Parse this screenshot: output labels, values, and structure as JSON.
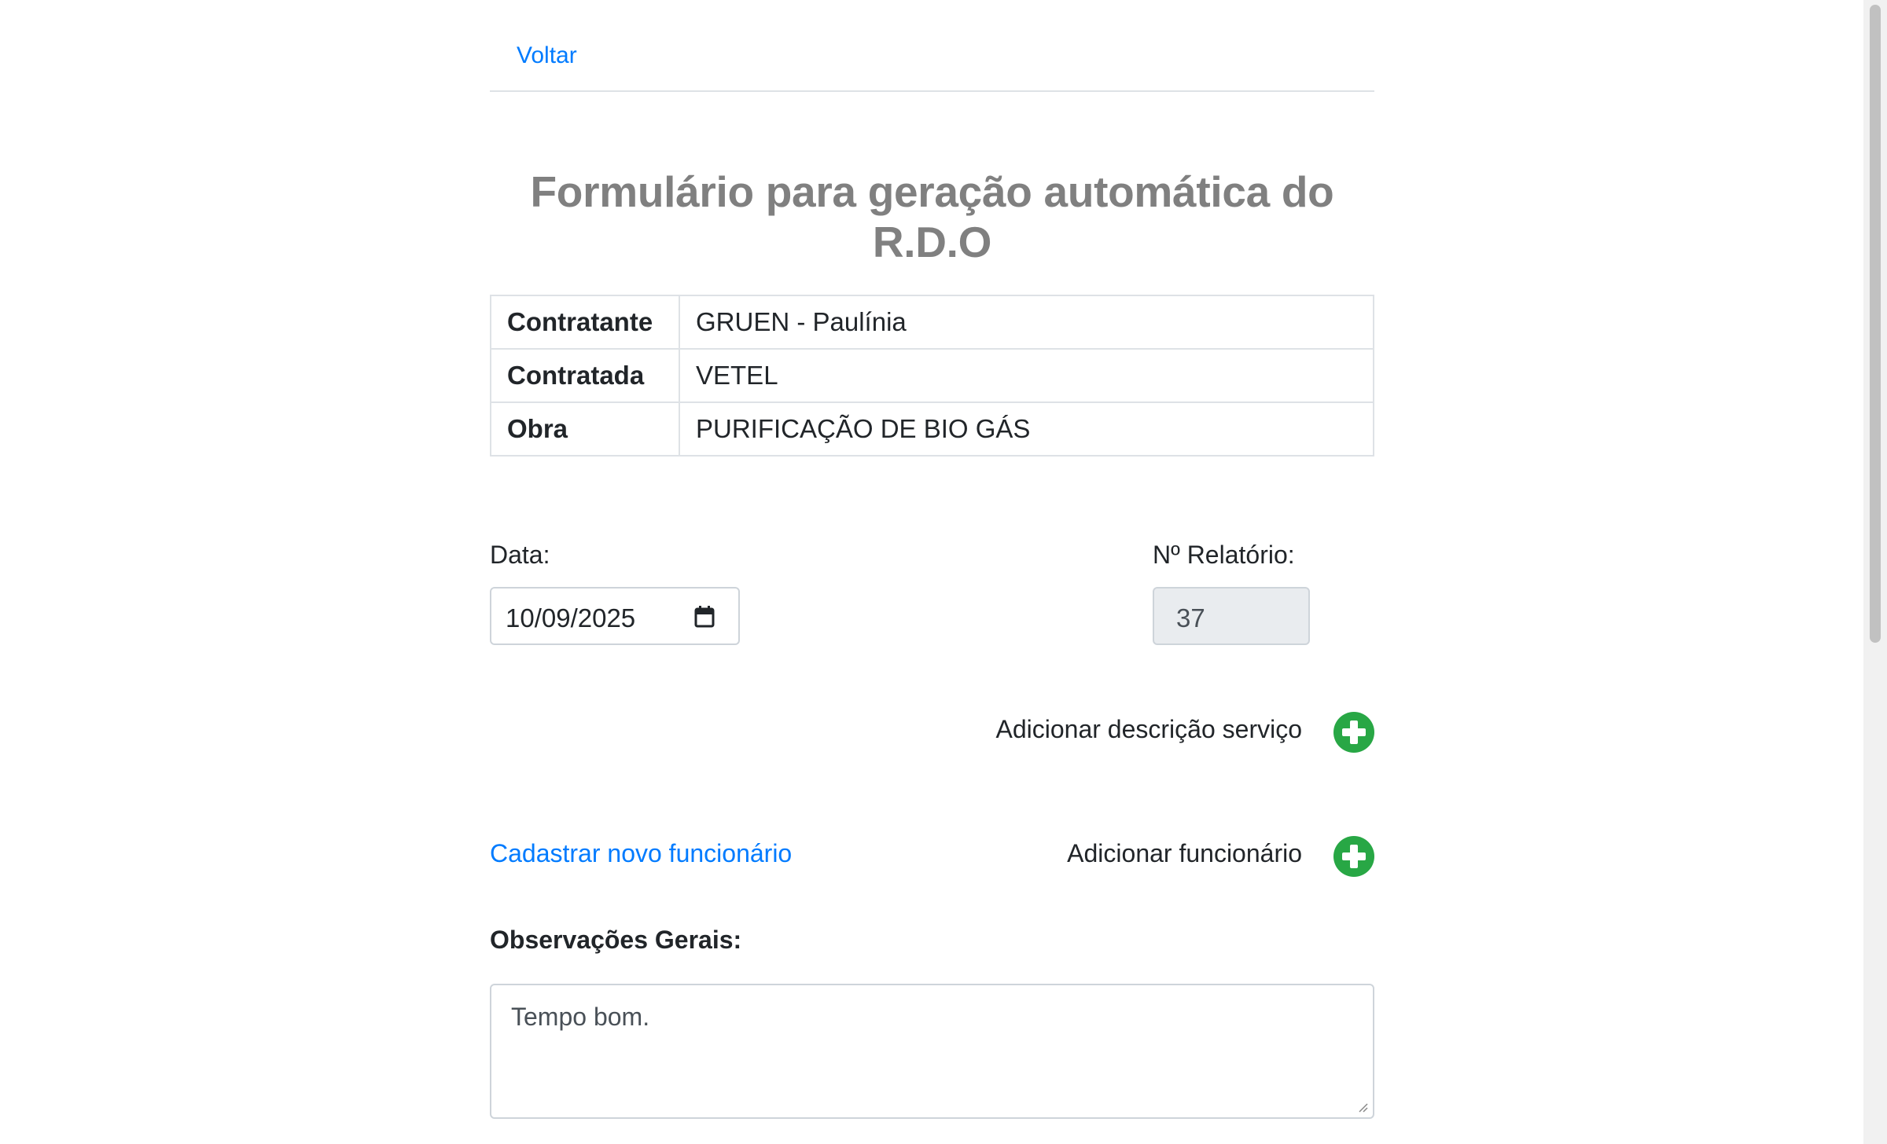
{
  "nav": {
    "back_label": "Voltar"
  },
  "page": {
    "title": "Formulário para geração automática do R.D.O"
  },
  "info_table": {
    "rows": [
      {
        "key": "Contratante",
        "value": "GRUEN - Paulínia"
      },
      {
        "key": "Contratada",
        "value": "VETEL"
      },
      {
        "key": "Obra",
        "value": "PURIFICAÇÃO DE BIO GÁS"
      }
    ]
  },
  "form": {
    "date_label": "Data:",
    "date_value": "10/09/2025",
    "report_label": "Nº Relatório:",
    "report_value": "37",
    "add_service_label": "Adicionar descrição serviço",
    "register_employee_link": "Cadastrar novo funcionário",
    "add_employee_label": "Adicionar funcionário",
    "observations_label": "Observações Gerais:",
    "observations_value": "Tempo bom."
  },
  "icons": {
    "calendar": "calendar-icon",
    "add": "plus-circle-icon"
  },
  "colors": {
    "link": "#007bff",
    "add_button": "#28a745",
    "title": "#808080",
    "readonly_bg": "#e9ecef"
  }
}
